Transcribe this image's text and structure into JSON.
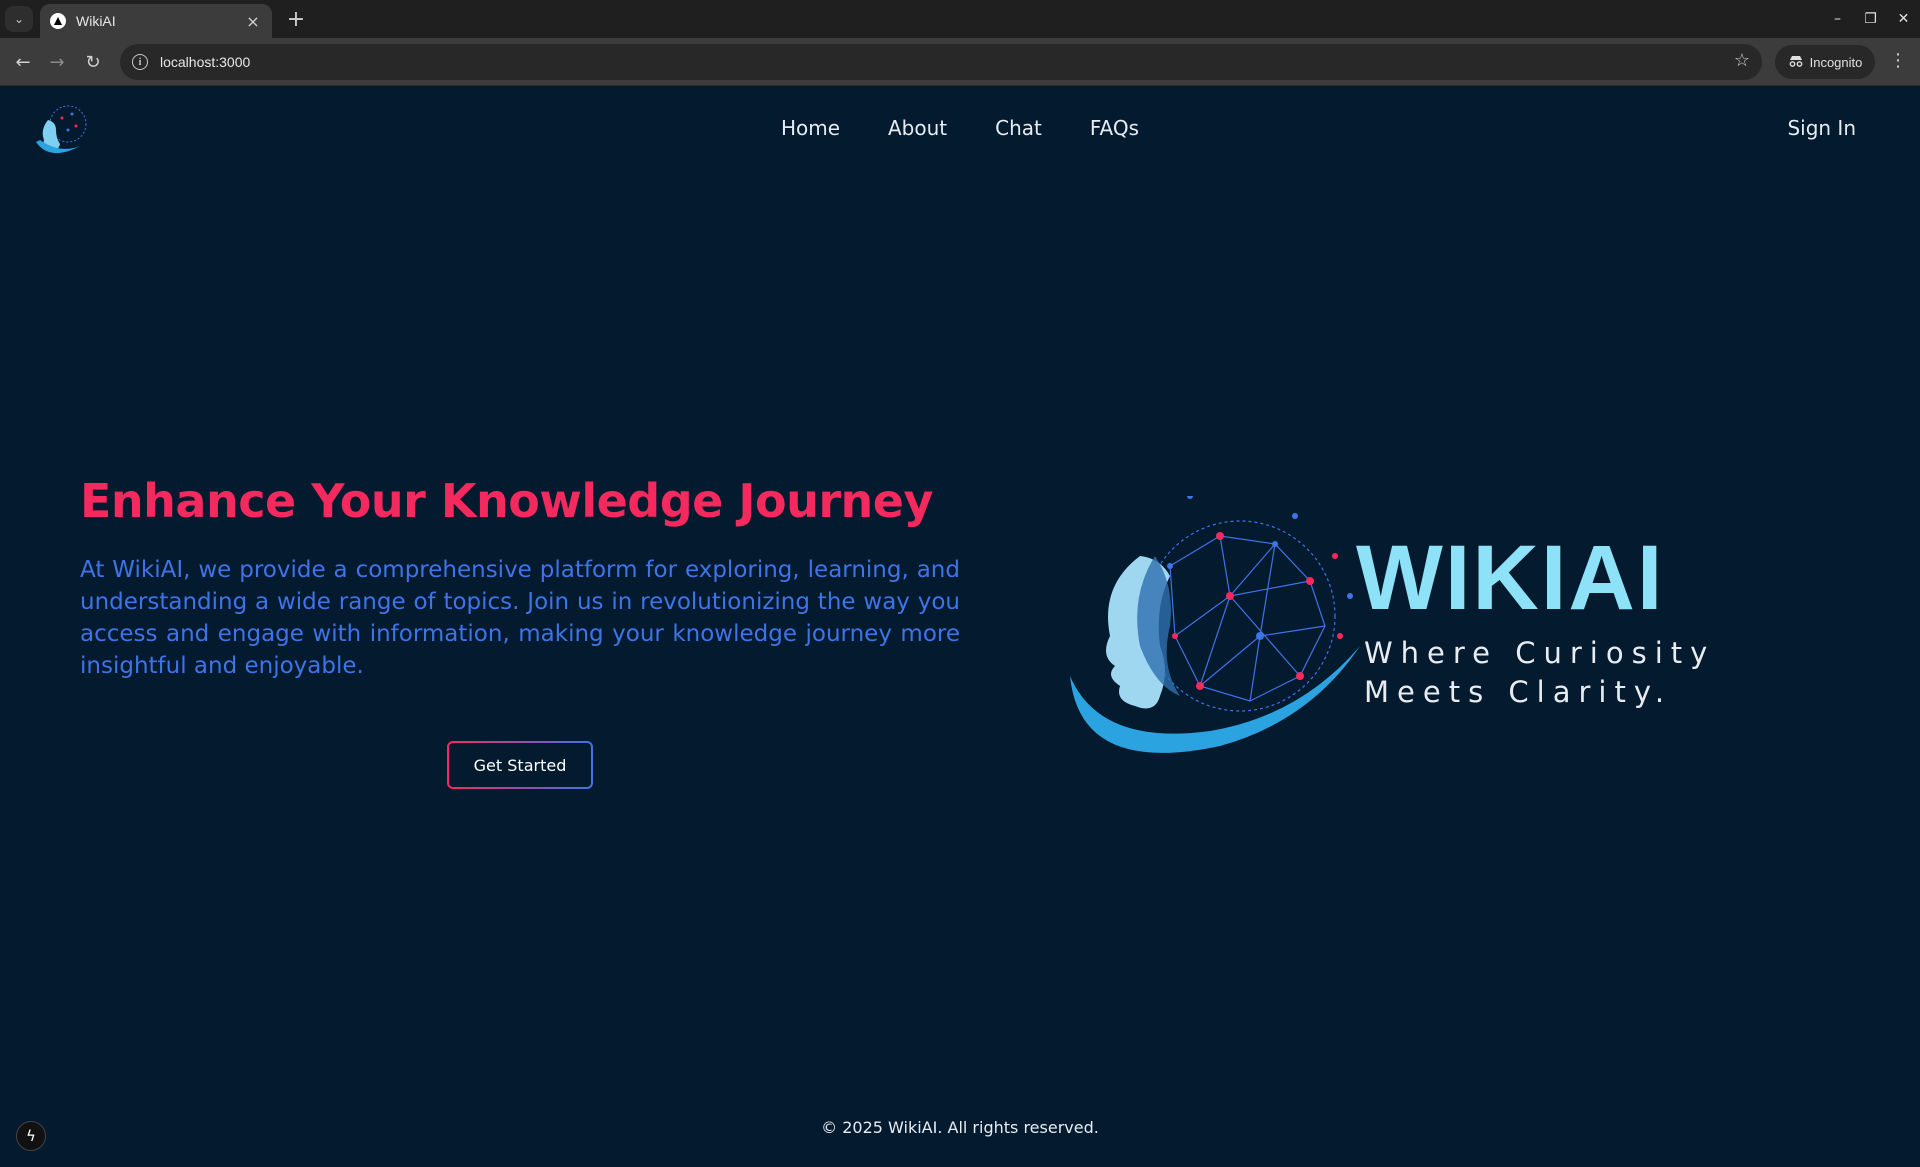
{
  "browser": {
    "tab_title": "WikiAI",
    "url": "localhost:3000",
    "incognito_label": "Incognito",
    "icons": [
      "tab-search-icon",
      "favicon-icon",
      "close-icon",
      "plus-icon",
      "minimize-icon",
      "restore-icon",
      "close-window-icon",
      "back-icon",
      "forward-icon",
      "reload-icon",
      "info-icon",
      "star-icon",
      "incognito-icon",
      "kebab-menu-icon"
    ]
  },
  "nav": {
    "items": [
      {
        "label": "Home"
      },
      {
        "label": "About"
      },
      {
        "label": "Chat"
      },
      {
        "label": "FAQs"
      }
    ],
    "sign_in": "Sign In"
  },
  "hero": {
    "title": "Enhance Your Knowledge Journey",
    "description": "At WikiAI, we provide a comprehensive platform for exploring, learning, and understanding a wide range of topics. Join us in revolutionizing the way you access and engage with information, making your knowledge journey more insightful and enjoyable.",
    "cta_label": "Get Started",
    "brand_name": "WIKIAI",
    "tagline_line1": "Where Curiosity",
    "tagline_line2": "Meets Clarity."
  },
  "footer": {
    "copyright": "© 2025 WikiAI. All rights reserved."
  },
  "colors": {
    "page_bg": "#031a2f",
    "title": "#f4295e",
    "body_text": "#3f73e8",
    "brand": "#8ee2f7"
  }
}
